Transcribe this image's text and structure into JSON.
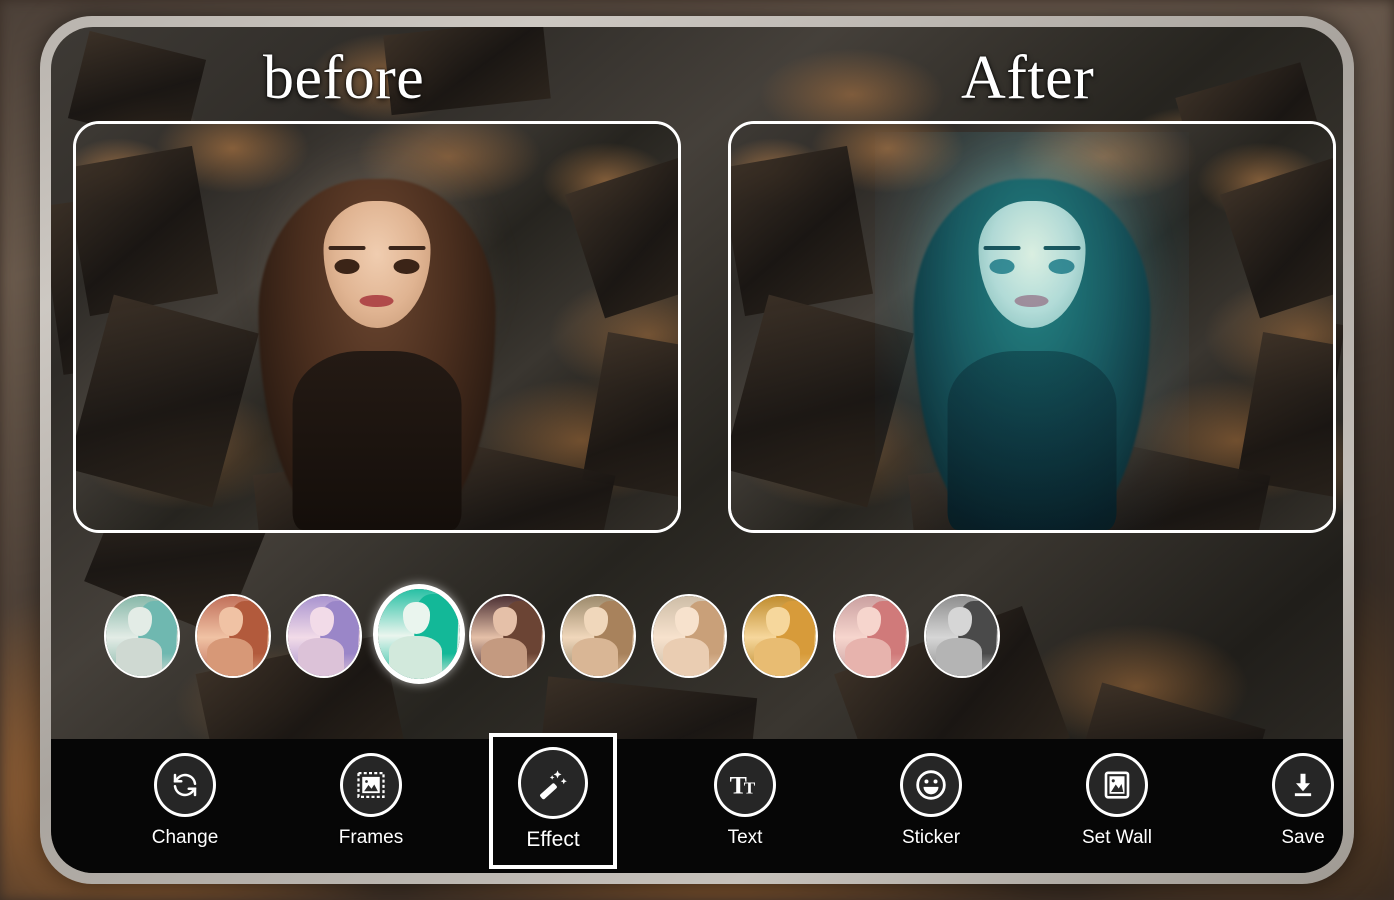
{
  "app": {
    "frame_color": "#bdb8b2",
    "screen_bg": "#2e2b27"
  },
  "compare": {
    "before_label": "before",
    "after_label": "After",
    "before_alt": "Original portrait of a woman with brown hair on a broken chocolate background",
    "after_alt": "Same portrait with a teal color effect applied"
  },
  "filters": {
    "selected_index": 3,
    "items": [
      {
        "name": "teal-mint",
        "hair": "#6fb8b0",
        "face": "#e3ece6",
        "body": "#cfd9d2",
        "bg": "#86b7a8",
        "ring": false
      },
      {
        "name": "warm-red",
        "hair": "#b25a3c",
        "face": "#f0c2a4",
        "body": "#d79877",
        "bg": "#c1705a",
        "ring": false
      },
      {
        "name": "lavender",
        "hair": "#9a86c8",
        "face": "#f2dbe8",
        "body": "#dcc2d8",
        "bg": "#a893cf",
        "ring": false
      },
      {
        "name": "bright-teal",
        "hair": "#13b898",
        "face": "#eaf5ee",
        "body": "#d2e9dc",
        "bg": "#27c0a4",
        "ring": true
      },
      {
        "name": "dark-plum",
        "hair": "#6b4434",
        "face": "#e5c0a8",
        "body": "#c49a80",
        "bg": "#4b2f33",
        "ring": false
      },
      {
        "name": "sepia-warm",
        "hair": "#a8825c",
        "face": "#f0d7bb",
        "body": "#d9b695",
        "bg": "#9c8a6c",
        "ring": false
      },
      {
        "name": "light-peach",
        "hair": "#c9a079",
        "face": "#f7e2cd",
        "body": "#eacdb2",
        "bg": "#cdbda7",
        "ring": false
      },
      {
        "name": "golden-amber",
        "hair": "#d79b3a",
        "face": "#f6d79c",
        "body": "#e8bc72",
        "bg": "#c08c2e",
        "ring": false
      },
      {
        "name": "rose-pink",
        "hair": "#d07a7a",
        "face": "#f6d5cd",
        "body": "#e7b3ad",
        "bg": "#caa0a0",
        "ring": false
      },
      {
        "name": "grayscale",
        "hair": "#4a4a4a",
        "face": "#d6d6d6",
        "body": "#b4b4b4",
        "bg": "#8e8e8e",
        "ring": false
      }
    ]
  },
  "toolbar": {
    "active_index": 2,
    "items": [
      {
        "label": "Change",
        "icon": "refresh-icon"
      },
      {
        "label": "Frames",
        "icon": "photo-frame-icon"
      },
      {
        "label": "Effect",
        "icon": "magic-wand-icon"
      },
      {
        "label": "Text",
        "icon": "text-size-icon"
      },
      {
        "label": "Sticker",
        "icon": "smiley-icon"
      },
      {
        "label": "Set Wall",
        "icon": "wallpaper-image-icon"
      },
      {
        "label": "Save",
        "icon": "download-icon"
      }
    ]
  }
}
